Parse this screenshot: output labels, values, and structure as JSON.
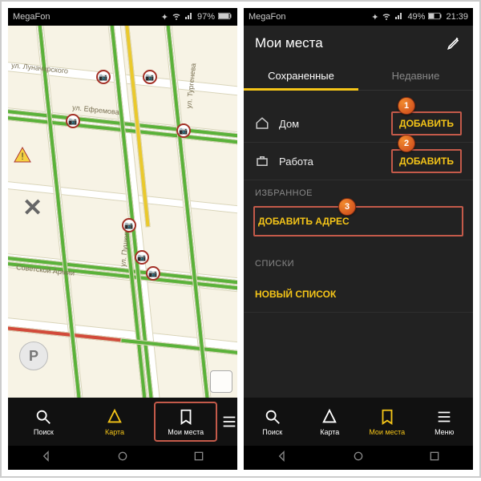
{
  "status_left": {
    "carrier": "MegaFon",
    "battery": "97%"
  },
  "status_right": {
    "carrier": "MegaFon",
    "battery": "49%",
    "time": "21:39"
  },
  "left_map": {
    "streets": [
      "ул. Луначарского",
      "ул. Ефремова",
      "ул. Тургенева",
      "ул. Пушкина",
      "Советской Армии"
    ]
  },
  "nav": {
    "search": "Поиск",
    "map": "Карта",
    "places": "Мои места",
    "menu": "Меню"
  },
  "right": {
    "title": "Мои места",
    "tabs": {
      "saved": "Сохраненные",
      "recent": "Недавние"
    },
    "home": "Дом",
    "work": "Работа",
    "add": "ДОБАВИТЬ",
    "fav_section": "ИЗБРАННОЕ",
    "add_addr": "ДОБАВИТЬ АДРЕС",
    "lists_section": "СПИСКИ",
    "new_list": "НОВЫЙ СПИСОК"
  },
  "markers": {
    "one": "1",
    "two": "2",
    "three": "3"
  }
}
